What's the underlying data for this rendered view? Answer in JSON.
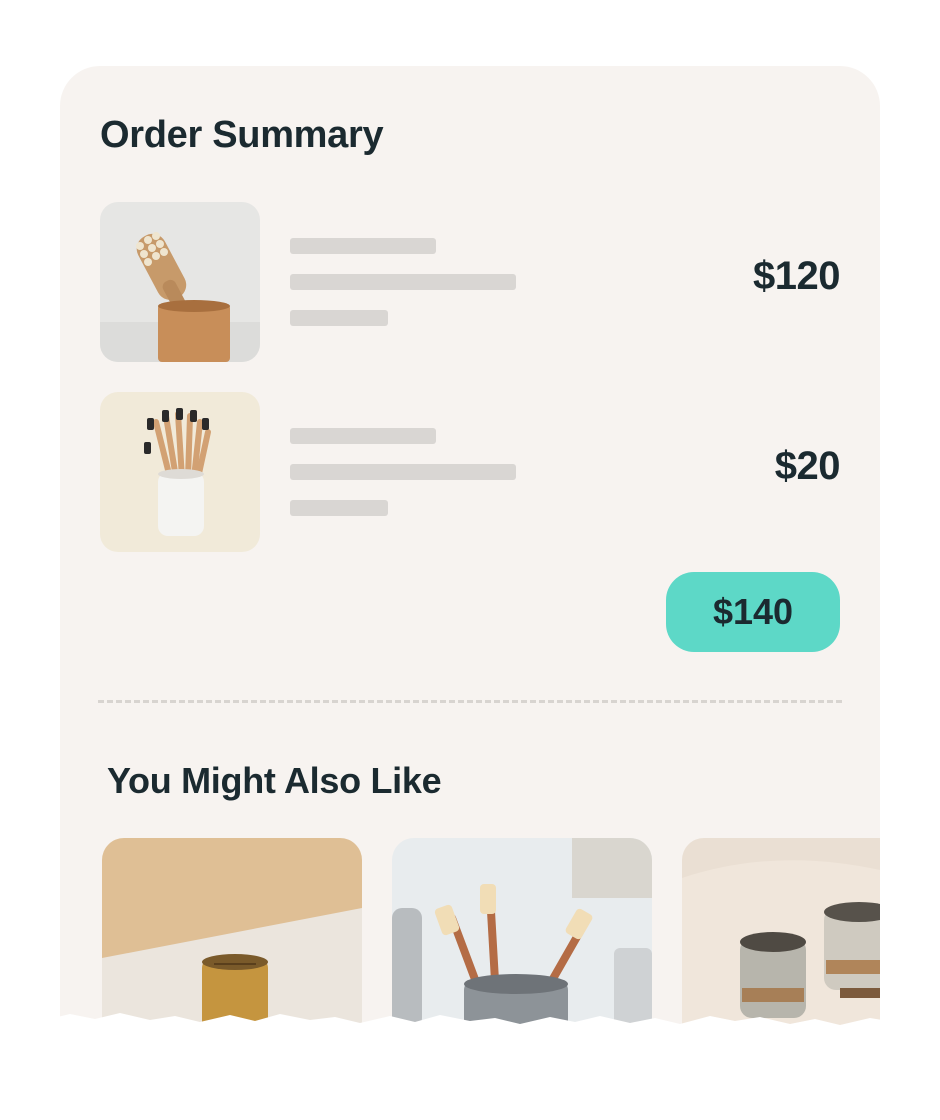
{
  "order_summary": {
    "title": "Order Summary",
    "items": [
      {
        "price": "$120",
        "image_icon": "hair-brush-in-cup-icon"
      },
      {
        "price": "$20",
        "image_icon": "toothbrushes-in-cup-icon"
      }
    ],
    "total": "$140"
  },
  "recommendations": {
    "title": "You Might Also Like",
    "items": [
      {
        "image_icon": "ceramic-cup-icon"
      },
      {
        "image_icon": "bamboo-toothbrushes-holder-icon"
      },
      {
        "image_icon": "stoneware-cups-icon"
      }
    ]
  },
  "colors": {
    "card_bg": "#f7f3f0",
    "accent": "#5dd8c7",
    "text": "#1b2a30",
    "skeleton": "#d9d6d3"
  }
}
